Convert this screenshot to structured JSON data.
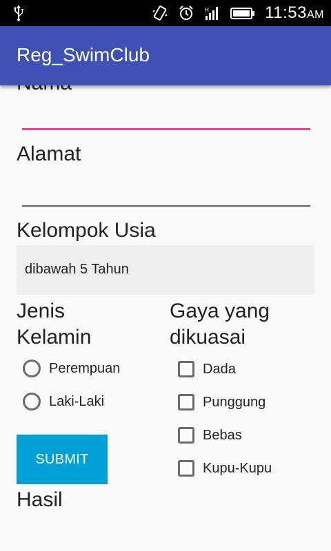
{
  "status_bar": {
    "time": "11:53",
    "ampm": "AM"
  },
  "app_bar": {
    "title": "Reg_SwimClub"
  },
  "form": {
    "nama_label": "Nama",
    "alamat_label": "Alamat",
    "kelompok_label": "Kelompok Usia",
    "kelompok_selected": "dibawah 5 Tahun",
    "gender_label_line1": "Jenis",
    "gender_label_line2": "Kelamin",
    "gender_options": [
      "Perempuan",
      "Laki-Laki"
    ],
    "gaya_label_line1": "Gaya yang",
    "gaya_label_line2": "dikuasai",
    "gaya_options": [
      "Dada",
      "Punggung",
      "Bebas",
      "Kupu-Kupu"
    ],
    "submit_label": "SUBMIT",
    "hasil_label": "Hasil"
  }
}
